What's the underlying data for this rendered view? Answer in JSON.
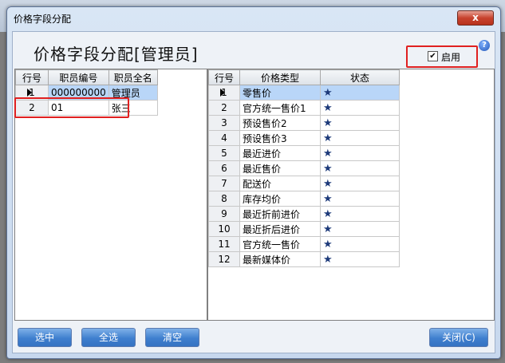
{
  "dialog": {
    "title": "价格字段分配",
    "close_symbol": "x",
    "heading": "价格字段分配[管理员]",
    "help_symbol": "?",
    "enable": {
      "label": "启用",
      "checked": true,
      "mark": "✔"
    }
  },
  "employees": {
    "columns": [
      "行号",
      "职员编号",
      "职员全名"
    ],
    "rows": [
      {
        "no": "1",
        "code": "000000000",
        "name": "管理员",
        "selected": true
      },
      {
        "no": "2",
        "code": "01",
        "name": "张三",
        "selected": false
      }
    ]
  },
  "prices": {
    "columns": [
      "行号",
      "价格类型",
      "状态"
    ],
    "status_symbol": "★",
    "rows": [
      {
        "no": "1",
        "type": "零售价"
      },
      {
        "no": "2",
        "type": "官方统一售价1"
      },
      {
        "no": "3",
        "type": "预设售价2"
      },
      {
        "no": "4",
        "type": "预设售价3"
      },
      {
        "no": "5",
        "type": "最近进价"
      },
      {
        "no": "6",
        "type": "最近售价"
      },
      {
        "no": "7",
        "type": "配送价"
      },
      {
        "no": "8",
        "type": "库存均价"
      },
      {
        "no": "9",
        "type": "最近折前进价"
      },
      {
        "no": "10",
        "type": "最近折后进价"
      },
      {
        "no": "11",
        "type": "官方统一售价"
      },
      {
        "no": "12",
        "type": "最新媒体价"
      }
    ]
  },
  "buttons": {
    "select": "选中",
    "select_all": "全选",
    "clear": "清空",
    "close": "关闭(C)"
  },
  "colors": {
    "highlight_box": "#e02020",
    "selection": "#b9d6f8",
    "star": "#1d3a7a"
  }
}
